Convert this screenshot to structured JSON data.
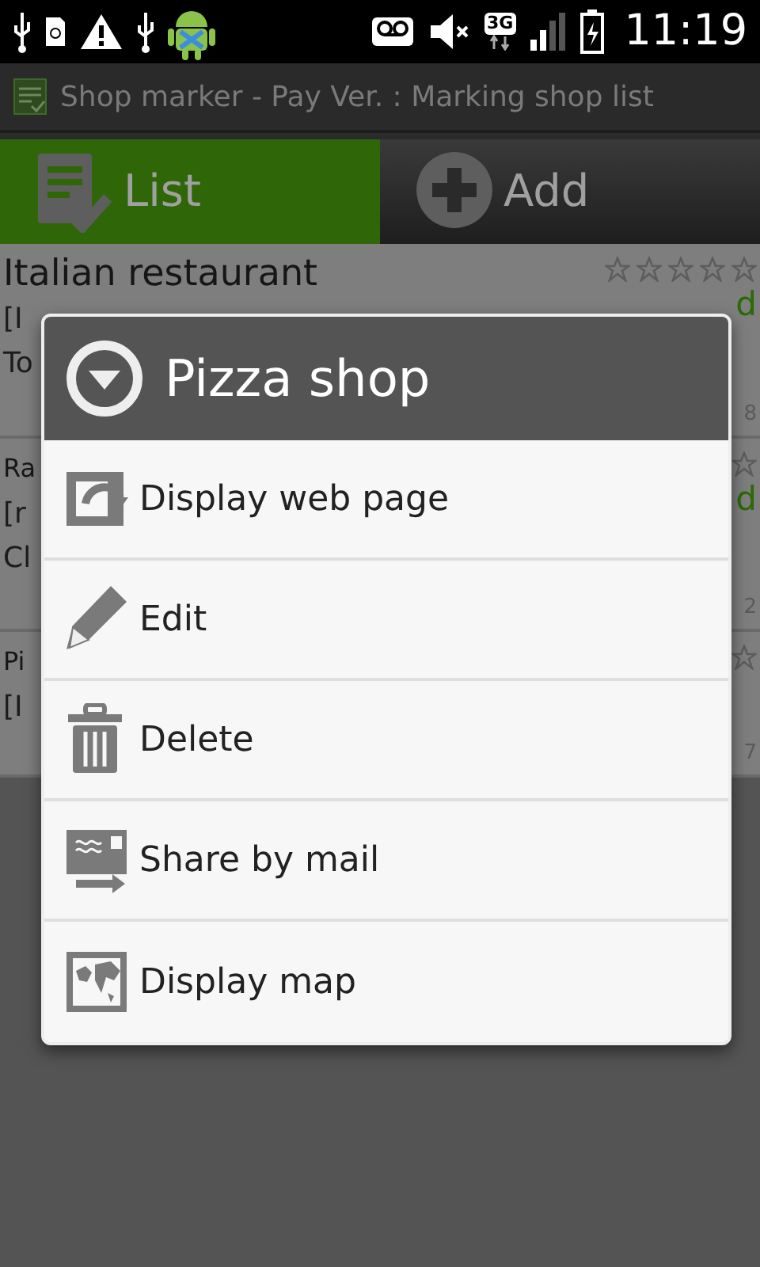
{
  "status_bar": {
    "network": "3G",
    "time": "11:19"
  },
  "app_bar": {
    "title": "Shop marker - Pay Ver. : Marking shop list"
  },
  "tabs": [
    {
      "label": "List",
      "kind": "list",
      "selected": true
    },
    {
      "label": "Add",
      "kind": "add",
      "selected": false
    }
  ],
  "shops": [
    {
      "kind": "full",
      "name": "Italian restaurant",
      "stars": 0,
      "line_2": "[I",
      "status": "d",
      "line_3": "To",
      "count": "8"
    },
    {
      "kind": "clipped",
      "name": "Ra",
      "line_2": "[r",
      "status": "d",
      "line_3": "Cl",
      "count": "2"
    },
    {
      "kind": "clipped",
      "name": "Pi",
      "line_2": "[I",
      "count": "7"
    }
  ],
  "dialog": {
    "title": "Pizza shop",
    "items": [
      {
        "kind": "web",
        "label": "Display web page"
      },
      {
        "kind": "edit",
        "label": "Edit"
      },
      {
        "kind": "delete",
        "label": "Delete"
      },
      {
        "kind": "mail",
        "label": "Share by mail"
      },
      {
        "kind": "map",
        "label": "Display map"
      }
    ]
  }
}
